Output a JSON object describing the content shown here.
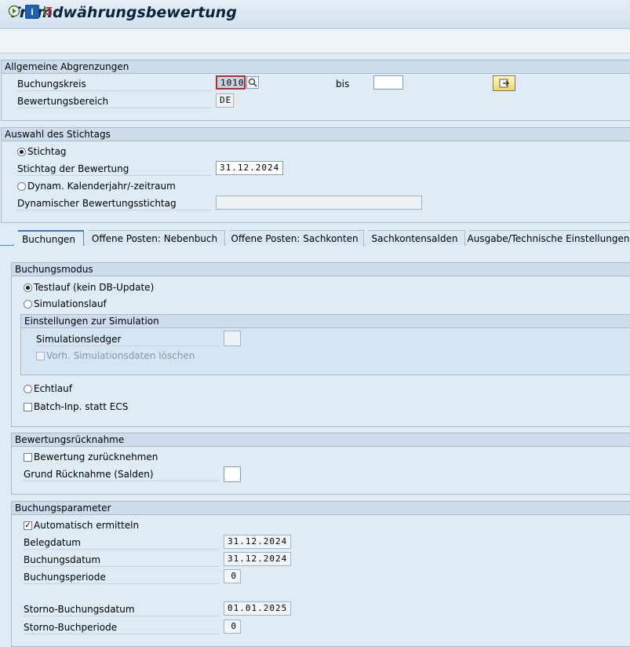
{
  "window": {
    "title": "Fremdwährungsbewertung"
  },
  "toolbar": {
    "icons": [
      "execute-icon",
      "info-icon",
      "selection-screen-icon"
    ]
  },
  "general": {
    "header": "Allgemeine Abgrenzungen",
    "company_code_label": "Buchungskreis",
    "company_code_value": "1010",
    "to_label": "bis",
    "to_value": "",
    "valuation_area_label": "Bewertungsbereich",
    "valuation_area_value": "DE"
  },
  "keydate": {
    "header": "Auswahl des Stichtags",
    "radio_keydate": "Stichtag",
    "keydate_label": "Stichtag der Bewertung",
    "keydate_value": "31.12.2024",
    "radio_dynamic": "Dynam. Kalenderjahr/-zeitraum",
    "dynamic_label": "Dynamischer Bewertungsstichtag",
    "dynamic_value": "",
    "selected": "Stichtag"
  },
  "tabs": [
    "Buchungen",
    "Offene Posten: Nebenbuch",
    "Offene Posten: Sachkonten",
    "Sachkontensalden",
    "Ausgabe/Technische Einstellungen"
  ],
  "active_tab": "Buchungen",
  "posting_mode": {
    "header": "Buchungsmodus",
    "test_run": "Testlauf (kein DB-Update)",
    "simulation_run": "Simulationslauf",
    "sim_header": "Einstellungen zur Simulation",
    "sim_ledger_label": "Simulationsledger",
    "sim_ledger_value": "",
    "delete_sim_label": "Vorh. Simulationsdaten löschen",
    "production_run": "Echtlauf",
    "batch_label": "Batch-Inp. statt ECS",
    "selected": "Testlauf (kein DB-Update)"
  },
  "reversal": {
    "header": "Bewertungsrücknahme",
    "reverse_label": "Bewertung zurücknehmen",
    "reason_label": "Grund Rücknahme (Salden)",
    "reason_value": ""
  },
  "params": {
    "header": "Buchungsparameter",
    "auto_label": "Automatisch ermitteln",
    "auto_checked": true,
    "doc_date_label": "Belegdatum",
    "doc_date_value": "31.12.2024",
    "post_date_label": "Buchungsdatum",
    "post_date_value": "31.12.2024",
    "period_label": "Buchungsperiode",
    "period_value": "0",
    "rev_date_label": "Storno-Buchungsdatum",
    "rev_date_value": "01.01.2025",
    "rev_period_label": "Storno-Buchperiode",
    "rev_period_value": "0"
  },
  "colors": {
    "accent": "#3f77b5",
    "background": "#dfebf5",
    "header": "#cddceb"
  }
}
